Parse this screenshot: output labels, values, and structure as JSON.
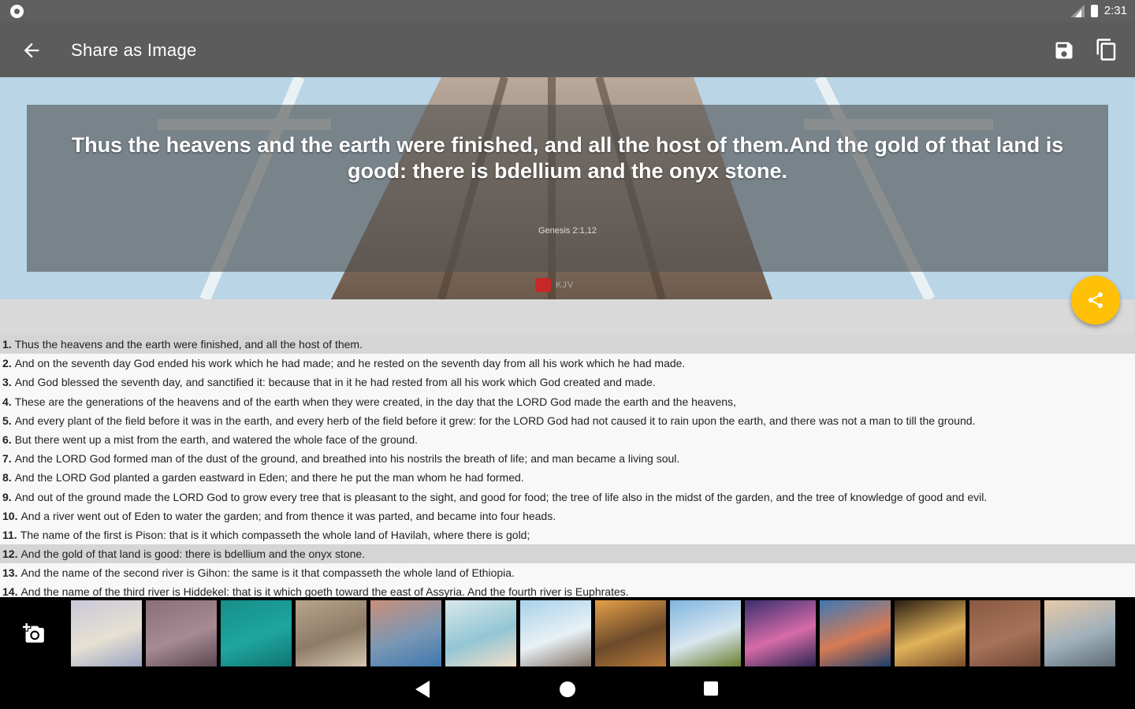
{
  "status": {
    "time": "2:31",
    "icons": [
      "notification-icon",
      "signal-icon",
      "battery-icon"
    ]
  },
  "toolbar": {
    "title": "Share as Image",
    "back_icon": "arrow-back-icon",
    "save_icon": "save-icon",
    "copy_icon": "copy-icon"
  },
  "preview": {
    "verse_text": "Thus the heavens and the earth were finished, and all the host of them.And the gold of that land is good: there is bdellium and the onyx stone.",
    "reference": "Genesis 2:1,12",
    "watermark": "KJV"
  },
  "fab": {
    "icon": "share-icon",
    "color": "#ffc107"
  },
  "verses": [
    {
      "num": "1.",
      "text": "Thus the heavens and the earth were finished, and all the host of them.",
      "selected": true
    },
    {
      "num": "2.",
      "text": "And on the seventh day God ended his work which he had made; and he rested on the seventh day from all his work which he had made.",
      "selected": false
    },
    {
      "num": "3.",
      "text": "And God blessed the seventh day, and sanctified it: because that in it he had rested from all his work which God created and made.",
      "selected": false
    },
    {
      "num": "4.",
      "text": "These are the generations of the heavens and of the earth when they were created, in the day that the LORD God made the earth and the heavens,",
      "selected": false
    },
    {
      "num": "5.",
      "text": "And every plant of the field before it was in the earth, and every herb of the field before it grew: for the LORD God had not caused it to rain upon the earth, and there was not a man to till the ground.",
      "selected": false
    },
    {
      "num": "6.",
      "text": "But there went up a mist from the earth, and watered the whole face of the ground.",
      "selected": false
    },
    {
      "num": "7.",
      "text": "And the LORD God formed man of the dust of the ground, and breathed into his nostrils the breath of life; and man became a living soul.",
      "selected": false
    },
    {
      "num": "8.",
      "text": "And the LORD God planted a garden eastward in Eden; and there he put the man whom he had formed.",
      "selected": false
    },
    {
      "num": "9.",
      "text": "And out of the ground made the LORD God to grow every tree that is pleasant to the sight, and good for food; the tree of life also in the midst of the garden, and the tree of knowledge of good and evil.",
      "selected": false
    },
    {
      "num": "10.",
      "text": "And a river went out of Eden to water the garden; and from thence it was parted, and became into four heads.",
      "selected": false
    },
    {
      "num": "11.",
      "text": "The name of the first is Pison: that is it which compasseth the whole land of Havilah, where there is gold;",
      "selected": false
    },
    {
      "num": "12.",
      "text": "And the gold of that land is good: there is bdellium and the onyx stone.",
      "selected": true
    },
    {
      "num": "13.",
      "text": "And the name of the second river is Gihon: the same is it that compasseth the whole land of Ethiopia.",
      "selected": false
    },
    {
      "num": "14.",
      "text": "And the name of the third river is Hiddekel: that is it which goeth toward the east of Assyria. And the fourth river is Euphrates.",
      "selected": false
    }
  ],
  "backgrounds": [
    {
      "name": "blossoms",
      "colors": [
        "#c9c7d8",
        "#e6e1d3",
        "#9ba3c2"
      ]
    },
    {
      "name": "purple-texture",
      "colors": [
        "#8a6f78",
        "#a68b93",
        "#5e4650"
      ]
    },
    {
      "name": "teal-pattern",
      "colors": [
        "#178f8a",
        "#1fa59f",
        "#107470"
      ]
    },
    {
      "name": "pebbles",
      "colors": [
        "#b9a58c",
        "#8d7b67",
        "#d6c6b0"
      ]
    },
    {
      "name": "gradient",
      "colors": [
        "#c98f7a",
        "#7a97b4",
        "#3e78b0"
      ]
    },
    {
      "name": "abstract-light",
      "colors": [
        "#d9e7ec",
        "#93c6d5",
        "#f2ddc9"
      ]
    },
    {
      "name": "pier",
      "colors": [
        "#a7d1ea",
        "#e8f1f5",
        "#7f7066"
      ]
    },
    {
      "name": "rail-sunset",
      "colors": [
        "#e7a04a",
        "#6b4a2a",
        "#b97a3a"
      ]
    },
    {
      "name": "field-sky",
      "colors": [
        "#7fb5e0",
        "#d8e6ef",
        "#6a7e2e"
      ]
    },
    {
      "name": "purple-sunset",
      "colors": [
        "#3a2f6e",
        "#d76ba8",
        "#2a2550"
      ]
    },
    {
      "name": "sea-dusk",
      "colors": [
        "#3e78b5",
        "#d77b55",
        "#1d3e6b"
      ]
    },
    {
      "name": "bokeh",
      "colors": [
        "#2b1e14",
        "#e0b25a",
        "#7a4e2a"
      ]
    },
    {
      "name": "brick",
      "colors": [
        "#8a5a42",
        "#a8725a",
        "#6e4634"
      ]
    },
    {
      "name": "lighthouse",
      "colors": [
        "#e8c9a8",
        "#9fb0bb",
        "#5d6b73"
      ]
    }
  ],
  "camera_icon": "add-photo-icon",
  "nav": {
    "back_icon": "nav-back-icon",
    "home_icon": "nav-home-icon",
    "recent_icon": "nav-recents-icon"
  }
}
